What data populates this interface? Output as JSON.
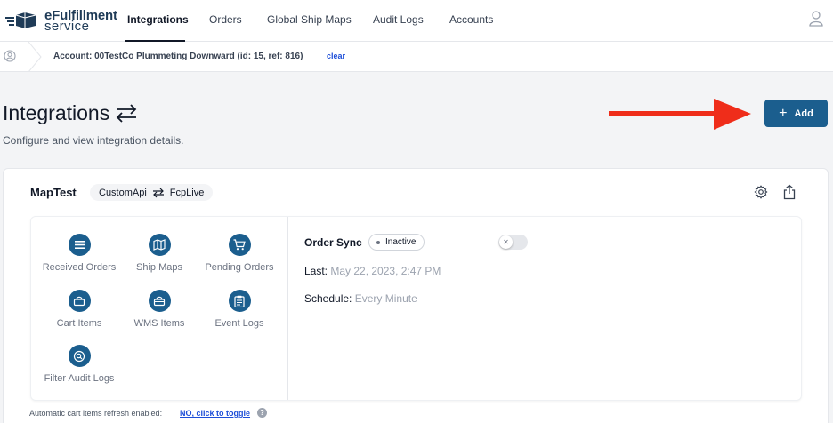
{
  "brand": {
    "line1": "eFulfillment",
    "line2": "service"
  },
  "nav": {
    "items": [
      {
        "label": "Integrations",
        "active": true
      },
      {
        "label": "Orders"
      },
      {
        "label": "Global Ship Maps"
      },
      {
        "label": "Audit Logs"
      },
      {
        "label": "Accounts"
      }
    ]
  },
  "account": {
    "text": "Account: 00TestCo Plummeting Downward (id: 15, ref: 816)",
    "clear": "clear"
  },
  "header": {
    "title": "Integrations",
    "subtitle": "Configure and view integration details.",
    "add_label": "Add"
  },
  "integration": {
    "name": "MapTest",
    "source": "CustomApi",
    "target": "FcpLive",
    "tiles": [
      {
        "label": "Received Orders",
        "icon": "list-icon"
      },
      {
        "label": "Ship Maps",
        "icon": "map-icon"
      },
      {
        "label": "Pending Orders",
        "icon": "cart-icon"
      },
      {
        "label": "Cart Items",
        "icon": "basket-icon"
      },
      {
        "label": "WMS Items",
        "icon": "box-icon"
      },
      {
        "label": "Event Logs",
        "icon": "clipboard-icon"
      },
      {
        "label": "Filter Audit Logs",
        "icon": "search-icon"
      }
    ],
    "sync": {
      "label": "Order Sync",
      "status": "Inactive",
      "last_label": "Last:",
      "last_value": "May 22, 2023, 2:47 PM",
      "schedule_label": "Schedule:",
      "schedule_value": "Every Minute"
    }
  },
  "footer": {
    "note": "Automatic cart items refresh enabled:",
    "link": "NO, click to toggle",
    "help": "?"
  },
  "colors": {
    "primary": "#1b5e8e",
    "arrow": "#ef2d1a"
  }
}
